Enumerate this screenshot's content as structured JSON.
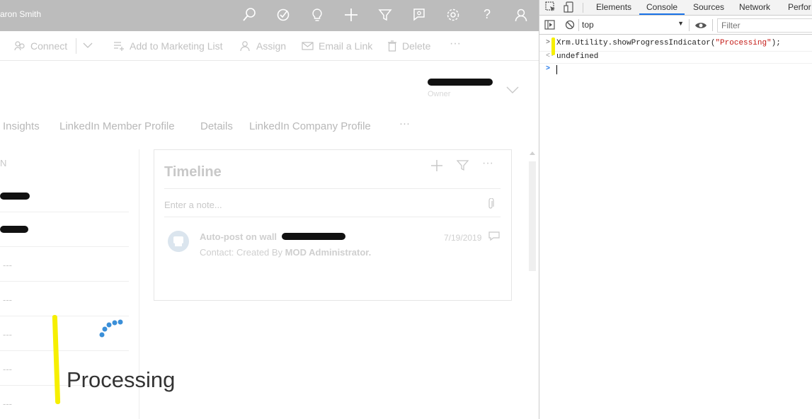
{
  "app": {
    "user_name": "aron Smith",
    "command_bar": {
      "connect": "Connect",
      "add_to_marketing_list": "Add to Marketing List",
      "assign": "Assign",
      "email_a_link": "Email a Link",
      "delete": "Delete",
      "more": "···"
    },
    "owner_label": "Owner",
    "tabs": [
      "Insights",
      "LinkedIn Member Profile",
      "Details",
      "LinkedIn Company Profile",
      "···"
    ],
    "left_card": {
      "header_fragment": "N",
      "rows": [
        "---",
        "---",
        "---",
        "---",
        "---"
      ]
    },
    "timeline": {
      "title": "Timeline",
      "note_placeholder": "Enter a note...",
      "post_title": "Auto-post on wall",
      "post_sub_prefix": "Contact: Created By ",
      "post_sub_author": "MOD Administrator.",
      "post_date": "7/19/2019"
    },
    "progress": {
      "message": "Processing"
    }
  },
  "devtools": {
    "tabs": [
      "Elements",
      "Console",
      "Sources",
      "Network",
      "Perfor"
    ],
    "active_tab": "Console",
    "context": "top",
    "filter_placeholder": "Filter",
    "console": {
      "input_code_prefix": "Xrm.Utility.showProgressIndicator(",
      "input_code_string": "\"Processing\"",
      "input_code_suffix": ");",
      "result": "undefined"
    }
  },
  "colors": {
    "top_bar": "#bcbcbc",
    "highlight": "#f6ef00",
    "spinner": "#3b8fd8",
    "devtools_active": "#1a73e8"
  }
}
